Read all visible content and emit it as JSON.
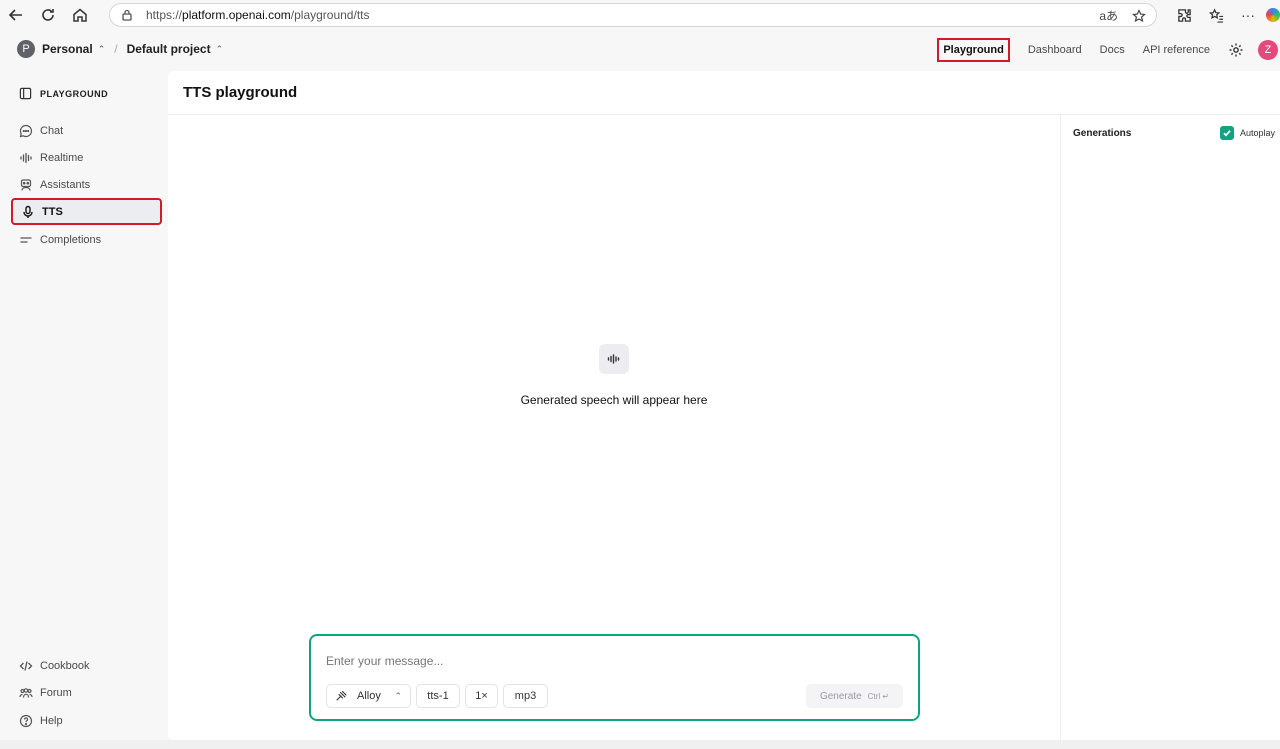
{
  "browser": {
    "url_prefix": "https://",
    "url_host": "platform.openai.com",
    "url_path": "/playground/tts",
    "translate_glyph": "aあ"
  },
  "header": {
    "org_initial": "P",
    "org_name": "Personal",
    "project_name": "Default project",
    "nav": [
      "Playground",
      "Dashboard",
      "Docs",
      "API reference"
    ],
    "user_initial": "Z"
  },
  "sidebar": {
    "section_title": "PLAYGROUND",
    "items": [
      {
        "label": "Chat",
        "icon": "chat-bubble-icon"
      },
      {
        "label": "Realtime",
        "icon": "audio-wave-icon"
      },
      {
        "label": "Assistants",
        "icon": "robot-icon"
      },
      {
        "label": "TTS",
        "icon": "microphone-icon"
      },
      {
        "label": "Completions",
        "icon": "lines-icon"
      }
    ],
    "footer": [
      {
        "label": "Cookbook",
        "icon": "code-icon"
      },
      {
        "label": "Forum",
        "icon": "people-icon"
      },
      {
        "label": "Help",
        "icon": "help-circle-icon"
      }
    ]
  },
  "main": {
    "title": "TTS playground",
    "empty_text": "Generated speech will appear here",
    "generations_label": "Generations",
    "autoplay_label": "Autoplay",
    "autoplay_checked": true
  },
  "composer": {
    "placeholder": "Enter your message...",
    "voice": "Alloy",
    "model": "tts-1",
    "speed": "1×",
    "format": "mp3",
    "generate_label": "Generate",
    "shortcut": "Ctrl ↵"
  },
  "colors": {
    "accent": "#10a37f",
    "highlight": "#d11a2a",
    "user_avatar": "#e5487d"
  }
}
